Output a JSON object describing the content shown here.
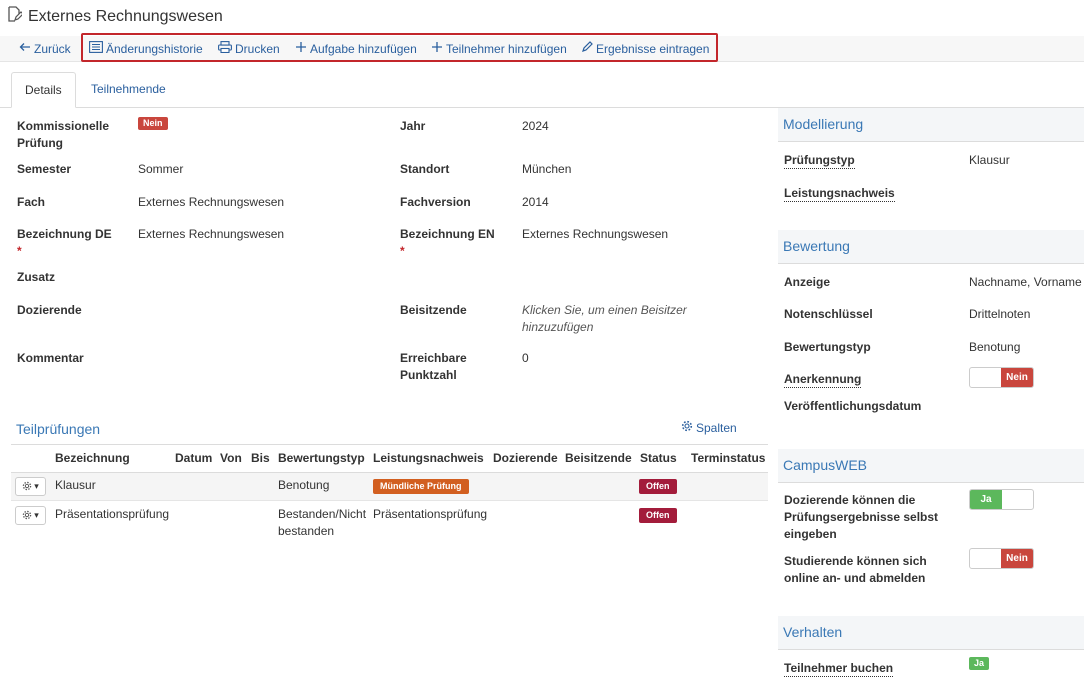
{
  "page": {
    "title": "Externes Rechnungswesen"
  },
  "toolbar": {
    "back": "Zurück",
    "history": "Änderungshistorie",
    "print": "Drucken",
    "add_task": "Aufgabe hinzufügen",
    "add_participant": "Teilnehmer hinzufügen",
    "enter_results": "Ergebnisse eintragen"
  },
  "tabs": {
    "details": "Details",
    "participants": "Teilnehmende"
  },
  "fields": {
    "kommissionelle_label_1": "Kommissionelle",
    "kommissionelle_label_2": "Prüfung",
    "kommissionelle_value": "Nein",
    "jahr_label": "Jahr",
    "jahr_value": "2024",
    "semester_label": "Semester",
    "semester_value": "Sommer",
    "standort_label": "Standort",
    "standort_value": "München",
    "fach_label": "Fach",
    "fach_value": "Externes Rechnungswesen",
    "fachversion_label": "Fachversion",
    "fachversion_value": "2014",
    "bez_de_label": "Bezeichnung DE",
    "bez_de_value": "Externes Rechnungswesen",
    "bez_en_label": "Bezeichnung EN",
    "bez_en_value": "Externes Rechnungswesen",
    "required_mark": "*",
    "zusatz_label": "Zusatz",
    "dozierende_label": "Dozierende",
    "beisitzende_label": "Beisitzende",
    "beisitzende_hint_1": "Klicken Sie, um einen Beisitzer",
    "beisitzende_hint_2": "hinzuzufügen",
    "kommentar_label": "Kommentar",
    "punkte_label_1": "Erreichbare",
    "punkte_label_2": "Punktzahl",
    "punkte_value": "0"
  },
  "teilpruefungen": {
    "title": "Teilprüfungen",
    "columns_button": "Spalten",
    "headers": [
      "Bezeichnung",
      "Datum",
      "Von",
      "Bis",
      "Bewertungstyp",
      "Leistungsnachweis",
      "Dozierende",
      "Beisitzende",
      "Status",
      "Terminstatus"
    ],
    "rows": [
      {
        "bezeichnung": "Klausur",
        "bewertungstyp_1": "Benotung",
        "bewertungstyp_2": "",
        "leistungsnachweis": "Mündliche Prüfung",
        "status": "Offen"
      },
      {
        "bezeichnung": "Präsentationsprüfung",
        "bewertungstyp_1": "Bestanden/Nicht",
        "bewertungstyp_2": "bestanden",
        "leistungsnachweis": "Präsentationsprüfung",
        "status": "Offen"
      }
    ]
  },
  "right": {
    "modellierung": {
      "title": "Modellierung",
      "pruefungstyp_label": "Prüfungstyp",
      "pruefungstyp_value": "Klausur",
      "leistungsnachweis_label": "Leistungsnachweis"
    },
    "bewertung": {
      "title": "Bewertung",
      "anzeige_label": "Anzeige",
      "anzeige_value": "Nachname, Vorname",
      "notenschluessel_label": "Notenschlüssel",
      "notenschluessel_value": "Drittelnoten",
      "bewertungstyp_label": "Bewertungstyp",
      "bewertungstyp_value": "Benotung",
      "anerkennung_label": "Anerkennung",
      "anerkennung_value": "Nein",
      "veroeffentlichung_label": "Veröffentlichungsdatum"
    },
    "campusweb": {
      "title": "CampusWEB",
      "doz_label_1": "Dozierende können die",
      "doz_label_2": "Prüfungsergebnisse selbst",
      "doz_label_3": "eingeben",
      "doz_value": "Ja",
      "stud_label_1": "Studierende können sich",
      "stud_label_2": "online an- und abmelden",
      "stud_value": "Nein"
    },
    "verhalten": {
      "title": "Verhalten",
      "buchen_label": "Teilnehmer buchen",
      "buchen_value": "Ja"
    }
  },
  "colors": {
    "link": "#2a5f9e",
    "section": "#3a78b5",
    "no": "#c9463d",
    "yes": "#5cb85c",
    "highlight": "#c3262b"
  }
}
